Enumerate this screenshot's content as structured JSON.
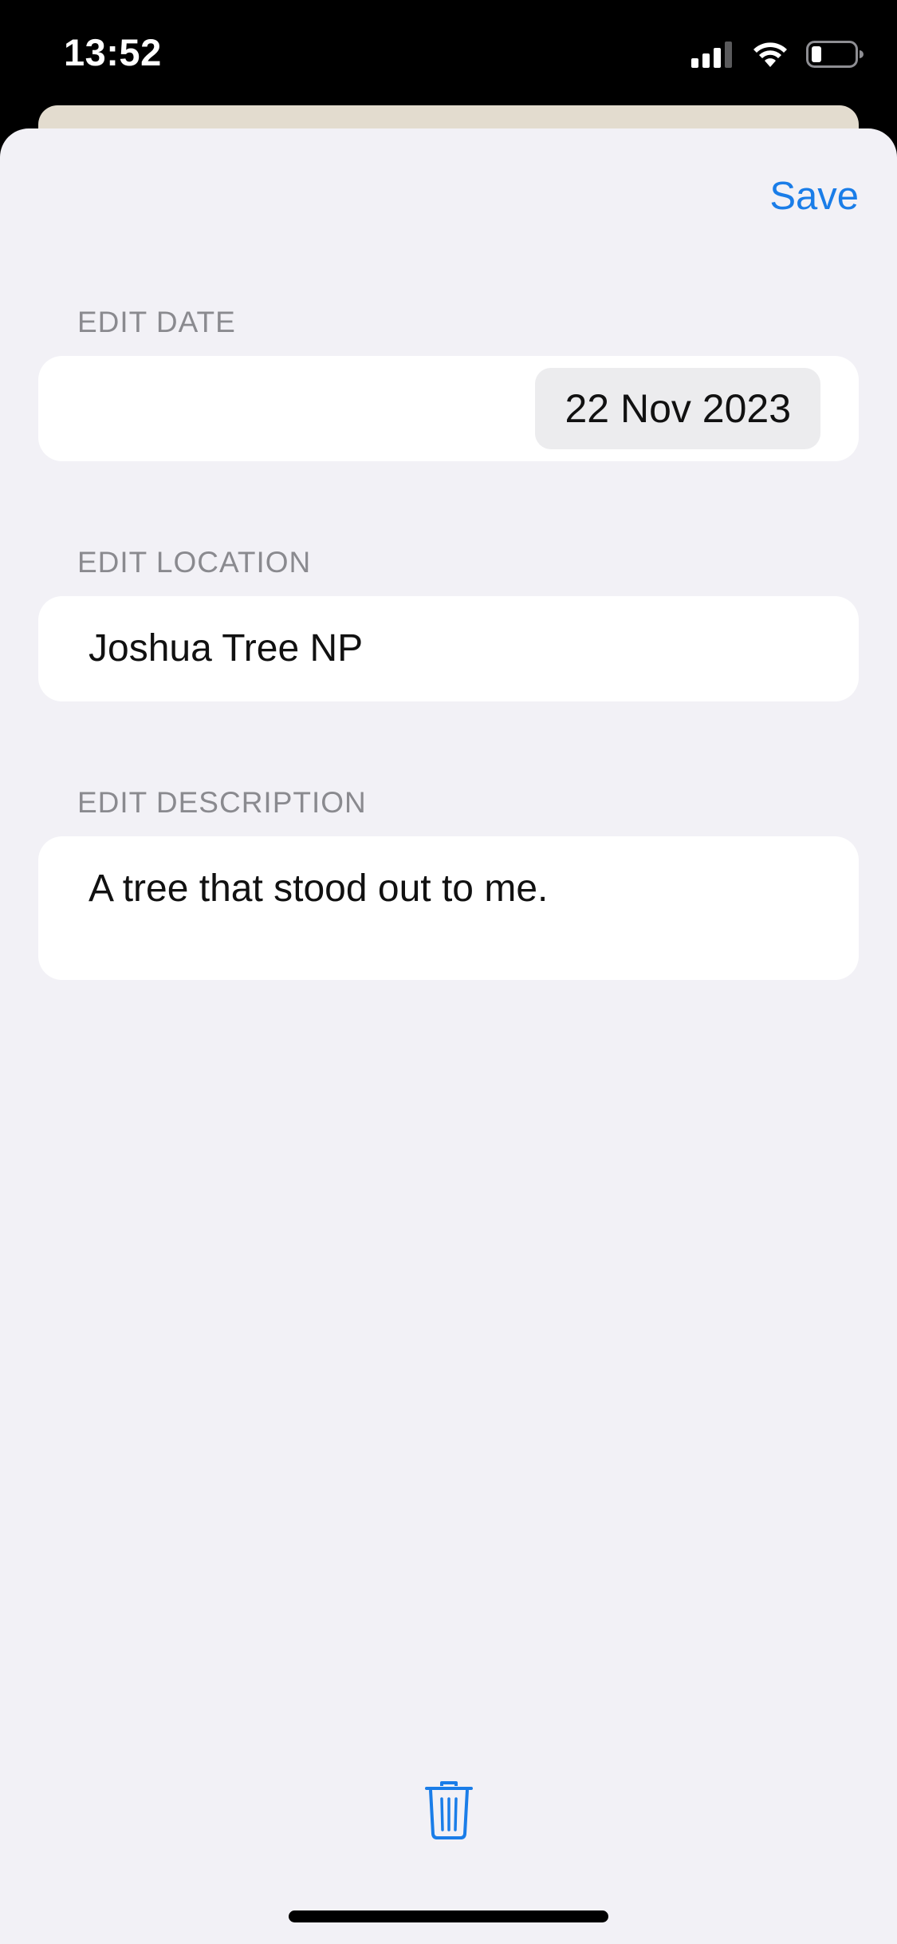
{
  "status_bar": {
    "time": "13:52",
    "icons": [
      "cellular-signal-icon",
      "wifi-icon",
      "battery-icon"
    ]
  },
  "toolbar": {
    "save_label": "Save"
  },
  "form": {
    "date_header": "EDIT DATE",
    "date_value": "22 Nov 2023",
    "location_header": "EDIT LOCATION",
    "location_value": "Joshua Tree NP",
    "description_header": "EDIT DESCRIPTION",
    "description_value": "A tree that stood out to me."
  },
  "actions": {
    "delete_icon": "trash-icon"
  },
  "colors": {
    "accent": "#1a7de8",
    "sheet_background": "#f2f1f6",
    "card_background": "#ffffff",
    "secondary_label": "#8a8a8f",
    "behind_card": "#e3dccf"
  }
}
